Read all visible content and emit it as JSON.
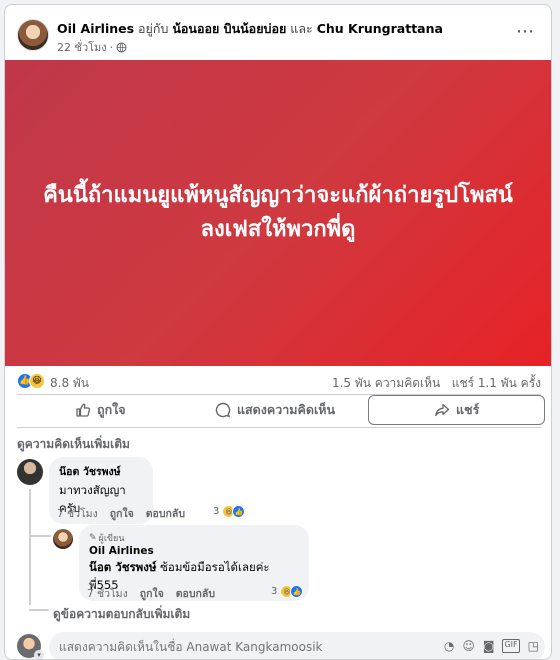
{
  "post": {
    "page_name": "Oil Airlines",
    "with_word": "อยู่กับ",
    "tagged_1": "น้อนออย บินน้อยบ่อย",
    "and_word": "และ",
    "tagged_2": "Chu Krungrattana",
    "time": "22 ชั่วโมง",
    "dot": "·",
    "more_icon": "⋯",
    "banner_text": "คืนนี้ถ้าแมนยูแพ้หนูสัญญาว่าจะแก้ผ้าถ่ายรูปโพสน์ลงเฟสให้พวกพี่ดู",
    "banner_color_start": "#c0374a",
    "banner_color_end": "#e62226"
  },
  "stats": {
    "reactions": "8.8 พัน",
    "comments": "1.5 พัน ความคิดเห็น",
    "shares": "แชร์ 1.1 พัน ครั้ง"
  },
  "actions": {
    "like": "ถูกใจ",
    "comment": "แสดงความคิดเห็น",
    "share": "แชร์"
  },
  "comments": {
    "view_more": "ดูความคิดเห็นเพิ่มเติม",
    "c1": {
      "name": "น๊อต วัชรพงษ์",
      "text": "มาทวงสัญญาครับ",
      "time": "7 ชั่วโมง",
      "like": "ถูกใจ",
      "reply": "ตอบกลับ",
      "react_count": "3"
    },
    "r1": {
      "badge": "ผู้เขียน",
      "name": "Oil Airlines",
      "mention": "น๊อต วัชรพงษ์",
      "text": " ซ้อมข้อมือรอได้เลยค่ะพี่555",
      "time": "7 ชั่วโมง",
      "like": "ถูกใจ",
      "reply": "ตอบกลับ",
      "react_count": "3"
    },
    "view_more_replies": "ดูข้อความตอบกลับเพิ่มเติม"
  },
  "composer": {
    "placeholder": "แสดงความคิดเห็นในชื่อ Anawat Kangkamoosik"
  },
  "colors": {
    "accent": "#1877f2",
    "muted": "#65676b"
  }
}
